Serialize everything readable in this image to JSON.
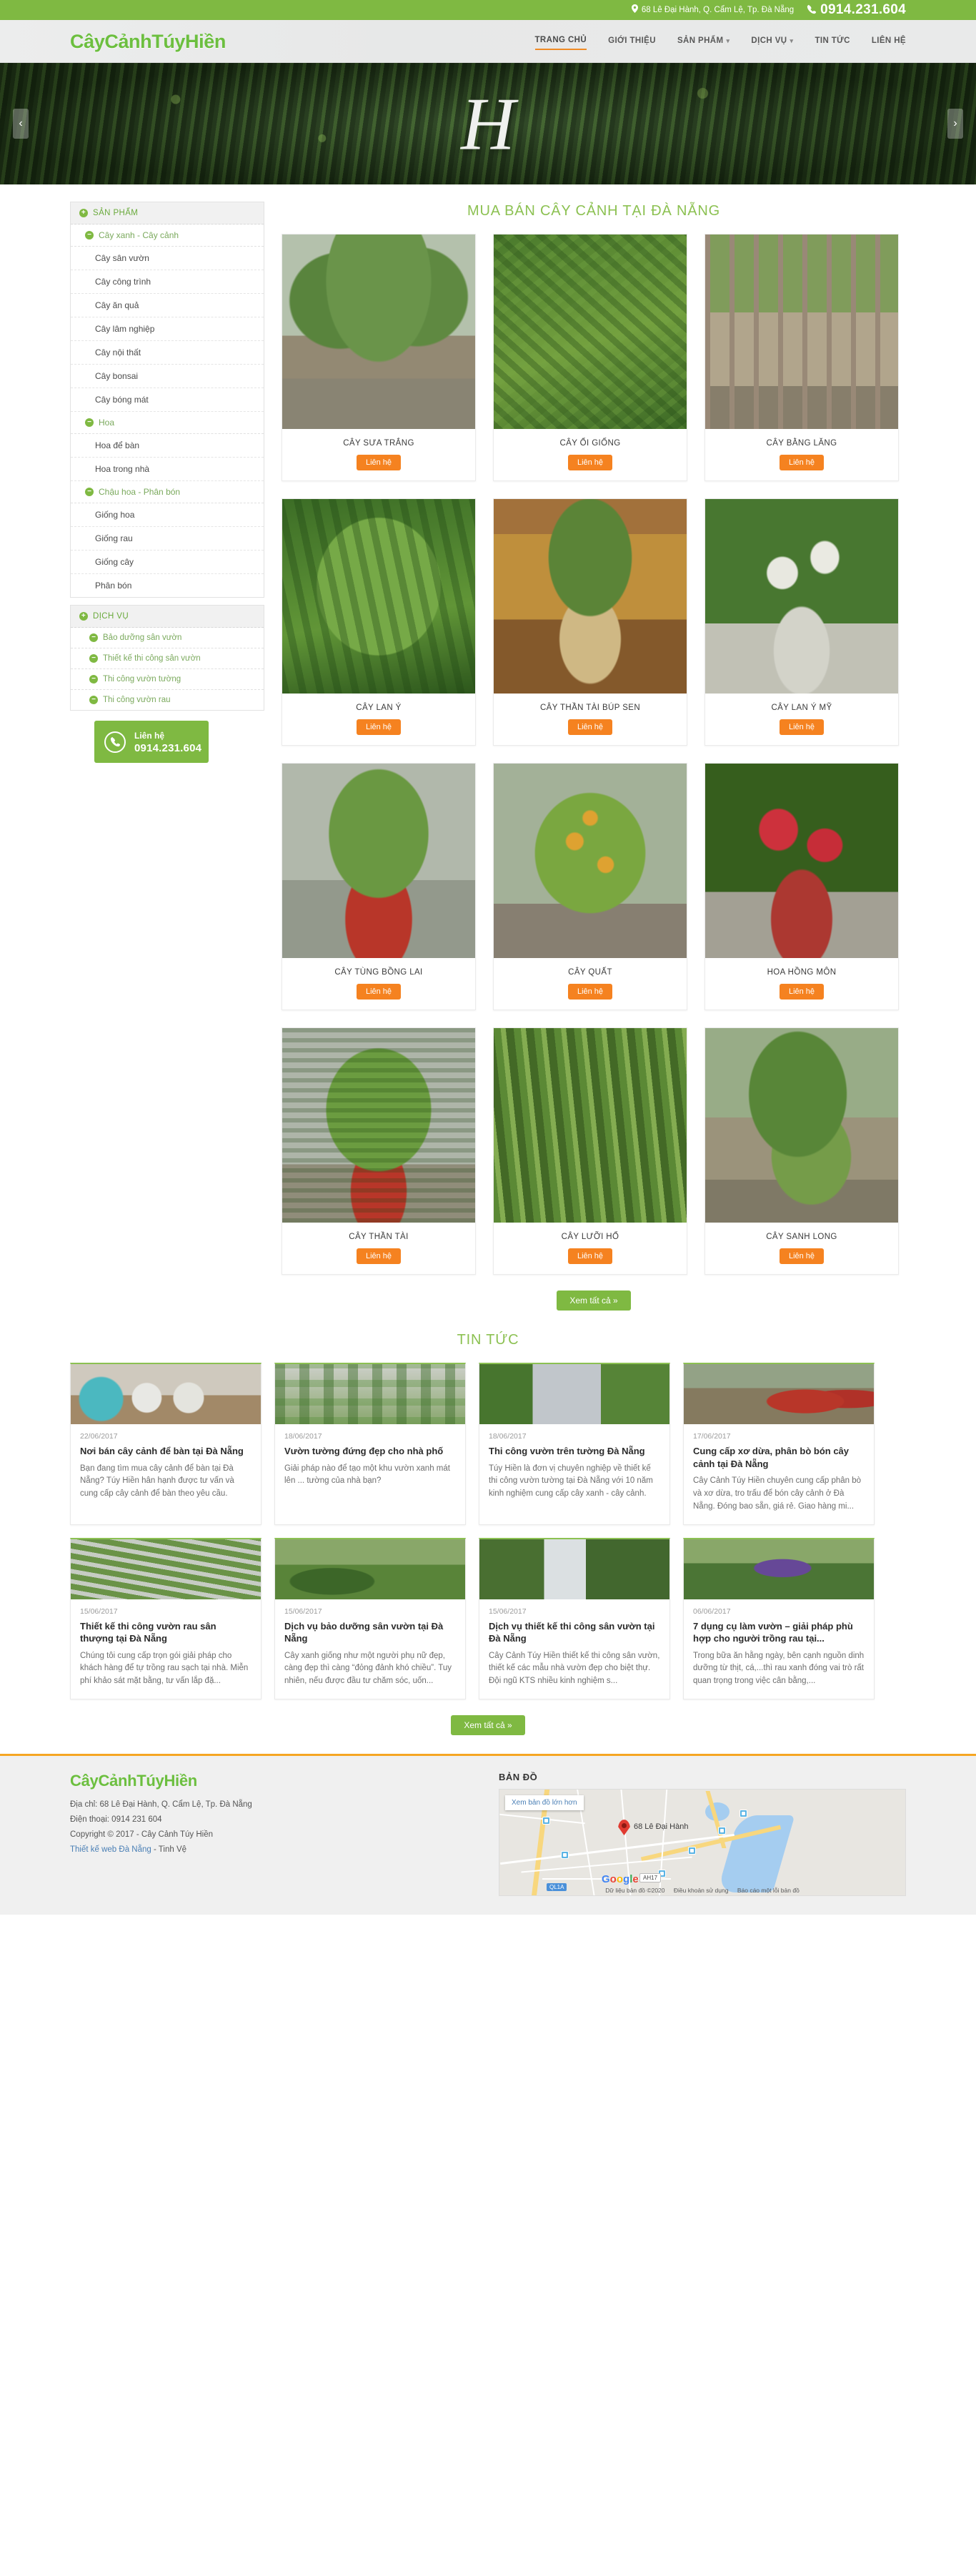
{
  "topbar": {
    "address": "68 Lê Đại Hành, Q. Cẩm Lệ, Tp. Đà Nẵng",
    "phone": "0914.231.604",
    "location_icon": "map-pin-icon",
    "phone_icon": "phone-icon"
  },
  "header": {
    "logo": "CâyCảnhTúyHiền",
    "nav": [
      {
        "label": "TRANG CHỦ",
        "active": true,
        "dropdown": false
      },
      {
        "label": "GIỚI THIỆU",
        "active": false,
        "dropdown": false
      },
      {
        "label": "SẢN PHẨM",
        "active": false,
        "dropdown": true
      },
      {
        "label": "DỊCH VỤ",
        "active": false,
        "dropdown": true
      },
      {
        "label": "TIN TỨC",
        "active": false,
        "dropdown": false
      },
      {
        "label": "LIÊN HỆ",
        "active": false,
        "dropdown": false
      }
    ]
  },
  "hero": {
    "monogram": "H",
    "prev_icon": "chevron-left-icon",
    "next_icon": "chevron-right-icon"
  },
  "sidebar": {
    "products_header": "SẢN PHẨM",
    "services_header": "DỊCH VỤ",
    "groups": [
      {
        "title": "Cây xanh - Cây cảnh",
        "items": [
          "Cây sân vườn",
          "Cây công trình",
          "Cây ăn quả",
          "Cây lâm nghiệp",
          "Cây nội thất",
          "Cây bonsai",
          "Cây bóng mát"
        ]
      },
      {
        "title": "Hoa",
        "items": [
          "Hoa để bàn",
          "Hoa trong nhà"
        ]
      },
      {
        "title": "Chậu hoa - Phân bón",
        "items": [
          "Giống hoa",
          "Giống rau",
          "Giống cây",
          "Phân bón"
        ]
      }
    ],
    "services": [
      "Bảo dưỡng sân vườn",
      "Thiết kế thi công sân vườn",
      "Thi công vườn tường",
      "Thi công vườn rau"
    ],
    "hotline": {
      "label": "Liên hệ",
      "number": "0914.231.604",
      "icon": "phone-circle-icon"
    }
  },
  "products_section": {
    "title": "MUA BÁN CÂY CẢNH TẠI ĐÀ NẴNG",
    "button_label": "Liên hệ",
    "view_all": "Xem tất cả »",
    "items": [
      {
        "name": "CÂY SƯA TRẮNG",
        "img": "large-bonsai-tree-on-stone-base"
      },
      {
        "name": "CÂY ỔI GIỐNG",
        "img": "guava-sapling-green-leaves"
      },
      {
        "name": "CÂY BẰNG LĂNG",
        "img": "crape-myrtle-trunks-nursery"
      },
      {
        "name": "CÂY LAN Ý",
        "img": "peace-lily-broad-leaves"
      },
      {
        "name": "CÂY THẦN TÀI BÚP SEN",
        "img": "aglaonema-in-glass-vase-indoor"
      },
      {
        "name": "CÂY LAN Ý MỸ",
        "img": "white-spathiphyllum-potted"
      },
      {
        "name": "CÂY TÙNG BỒNG LAI",
        "img": "juniper-bonsai-in-red-pot"
      },
      {
        "name": "CÂY QUẤT",
        "img": "kumquat-tree-with-orange-fruit"
      },
      {
        "name": "HOA HỒNG MÔN",
        "img": "red-anthurium-flowers-potted"
      },
      {
        "name": "CÂY THẦN TÀI",
        "img": "money-plant-in-red-pot"
      },
      {
        "name": "CÂY LƯỠI HỔ",
        "img": "snake-plant-sansevieria"
      },
      {
        "name": "CÂY SANH LONG",
        "img": "ficus-bonsai-outdoor-garden"
      }
    ]
  },
  "news_section": {
    "title": "TIN TỨC",
    "view_all": "Xem tất cả »",
    "items": [
      {
        "date": "22/06/2017",
        "title": "Nơi bán cây cảnh để bàn tại Đà Nẵng",
        "desc": "Bạn đang tìm mua cây cảnh để bàn tại Đà Nẵng? Túy Hiền hân hạnh được tư vấn và cung cấp cây cảnh để bàn theo yêu cầu.",
        "img": "small-desk-plants-in-colorful-pots"
      },
      {
        "date": "18/06/2017",
        "title": "Vườn tường đứng đẹp cho nhà phố",
        "desc": "Giải pháp nào để tạo một khu vườn xanh mát lên ... tường của nhà bạn?",
        "img": "vertical-green-wall-garden"
      },
      {
        "date": "18/06/2017",
        "title": "Thi công vườn trên tường Đà Nẵng",
        "desc": "Túy Hiền là đơn vị chuyên nghiệp về thiết kế thi công vườn tường tại Đà Nẵng với 10 năm kinh nghiệm cung cấp cây xanh - cây cảnh.",
        "img": "green-wall-building-facade"
      },
      {
        "date": "17/06/2017",
        "title": "Cung cấp xơ dừa, phân bò bón cây cảnh tại Đà Nẵng",
        "desc": "Cây Cảnh Túy Hiền chuyên cung cấp phân bò và xơ dừa, tro trấu để bón cây cảnh ở Đà Nẵng. Đóng bao sẵn, giá rẻ. Giao hàng mi...",
        "img": "red-fertilizer-sacks-in-field"
      },
      {
        "date": "15/06/2017",
        "title": "Thiết kế thi công vườn rau sân thượng tại Đà Nẵng",
        "desc": "Chúng tôi cung cấp trọn gói giải pháp cho khách hàng để tự trồng rau sạch tại nhà. Miễn phí khảo sát mặt bằng, tư vấn lắp đặ...",
        "img": "rooftop-vegetable-garden-rows"
      },
      {
        "date": "15/06/2017",
        "title": "Dịch vụ bảo dưỡng sân vườn tại Đà Nẵng",
        "desc": "Cây xanh giống như một người phụ nữ đẹp, càng đẹp thì càng “đỏng đảnh khó chiều”. Tuy nhiên, nếu được đầu tư chăm sóc, uốn...",
        "img": "gardeners-maintaining-lawn"
      },
      {
        "date": "15/06/2017",
        "title": "Dịch vụ thiết kế thi công sân vườn tại Đà Nẵng",
        "desc": "Cây Cảnh Túy Hiền thiết kế thi công sân vườn, thiết kế các mẫu nhà vườn đẹp cho biệt thự. Đội ngũ KTS nhiều kinh nghiệm s...",
        "img": "garden-waterfall-landscape"
      },
      {
        "date": "06/06/2017",
        "title": "7 dụng cụ làm vườn – giải pháp phù hợp cho người trồng rau tại...",
        "desc": "Trong bữa ăn hằng ngày, bên cạnh nguồn dinh dưỡng từ thịt, cá,...thì rau xanh đóng vai trò rất quan trọng trong việc cân bằng,...",
        "img": "purple-rose-and-garden-tools"
      }
    ]
  },
  "footer": {
    "logo": "CâyCảnhTúyHiền",
    "address": "Địa chỉ: 68 Lê Đại Hành, Q. Cẩm Lệ, Tp. Đà Nẵng",
    "phone": "Điện thoại: 0914 231 604",
    "copyright": "Copyright © 2017 - Cây Cảnh Túy Hiền",
    "credit_link": "Thiết kế web Đà Nẵng",
    "credit_rest": " - Tinh Vệ",
    "map_heading": "BẢN ĐỒ",
    "map": {
      "view_larger": "Xem bản đồ lớn hơn",
      "pin_label": "68 Lê Đại Hành",
      "brand_letters": [
        "G",
        "o",
        "o",
        "g",
        "l",
        "e"
      ],
      "data_note": "Dữ liệu bản đồ ©2020",
      "terms": "Điều khoản sử dụng",
      "report": "Báo cáo một lỗi bản đồ",
      "road_badge_1": "QL1A",
      "road_badge_2": "AH17"
    }
  },
  "colors": {
    "green": "#7fb942",
    "green_title": "#8cc152",
    "orange": "#f58220",
    "orange_accent": "#f5a623",
    "link_blue": "#4a7fb5"
  }
}
